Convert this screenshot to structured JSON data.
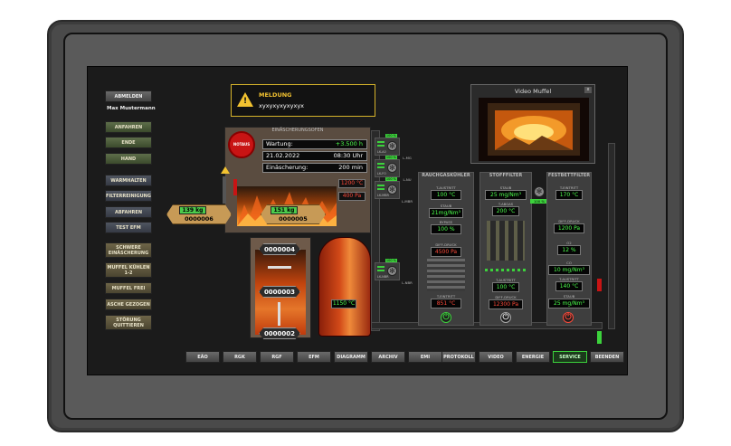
{
  "user": {
    "logout_label": "ABMELDEN",
    "name": "Max Mustermann"
  },
  "left_menu": {
    "group1": [
      "ANFAHREN",
      "ENDE",
      "HAND"
    ],
    "group2": [
      "WARMHALTEN",
      "FILTERREINIGUNG",
      "ABFAHREN",
      "TEST EFM"
    ],
    "group3": [
      "SCHWERE EINÄSCHERUNG",
      "MUFFEL KÜHLEN 1-2",
      "MUFFEL FREI",
      "ASCHE GEZOGEN",
      "STÖRUNG QUITTIEREN"
    ]
  },
  "alarm": {
    "title": "MELDUNG",
    "text": "xyxyxyxyxyxyx"
  },
  "video": {
    "title": "Video Muffel",
    "close": "x"
  },
  "oven": {
    "title": "EINÄSCHERUNGSOFEN",
    "estop_label": "NOTAUS",
    "wartung_label": "Wartung:",
    "wartung_value": "+3.500 h",
    "date": "21.02.2022",
    "time": "08:30 Uhr",
    "einaescherung_label": "Einäscherung:",
    "einaescherung_value": "200 min",
    "temp": "1200 °C",
    "pressure": "400 Pa"
  },
  "coffin_left": {
    "weight": "139 kg",
    "id": "0000006"
  },
  "coffin_oven": {
    "weight": "151 kg",
    "id": "0000005"
  },
  "chamber_ids": [
    "0000004",
    "0000003",
    "0000002"
  ],
  "tank_temp": "1150 °C",
  "fans": [
    {
      "label": "LK-A0",
      "pct": "100 %"
    },
    {
      "label": "LK-FO",
      "pct": "100 %"
    },
    {
      "label": "LK-MBR",
      "pct": "100 %"
    },
    {
      "label": "LK-NBR",
      "pct": "100 %"
    }
  ],
  "fan_tags": [
    "L-MG",
    "L-NU",
    "L-MBR",
    "L-NBR"
  ],
  "rauchgas": {
    "title": "RAUCHGASKÜHLER",
    "t_austritt_label": "T-AUSTRITT",
    "t_austritt": "100 °C",
    "staub_label": "STAUB",
    "staub": "21mg/Nm³",
    "bypass_label": "BYPASS",
    "bypass": "100 %",
    "diff_label": "DIFF-DRUCK",
    "diff": "4500 Pa",
    "t_eintritt_label": "T-EINTRITT",
    "t_eintritt": "851 °C"
  },
  "stoff": {
    "title": "STOFFFILTER",
    "staub_label": "STAUB",
    "staub": "25 mg/Nm³",
    "t_abgas_label": "T-ABGAS",
    "t_abgas": "200 °C",
    "t_austritt_label": "T-AUSTRITT",
    "t_austritt": "100 °C",
    "diff_label": "DIFF-DRUCK",
    "diff": "12300 Pa",
    "fan_pct": "100 %"
  },
  "fest": {
    "title": "FESTBETTFILTER",
    "t_eintritt_label": "T-EINTRITT",
    "t_eintritt": "170 °C",
    "diff_label": "DIFF-DRUCK",
    "diff": "1200 Pa",
    "o2_label": "O2",
    "o2": "12 %",
    "co_label": "CO",
    "co": "10 mg/Nm³",
    "t_austritt_label": "T-AUSTRITT",
    "t_austritt": "140 °C",
    "staub_label": "STAUB",
    "staub": "25 mg/Nm³"
  },
  "bottom_nav": [
    "EÄO",
    "RGK",
    "RGF",
    "EFM",
    "DIAGRAMM",
    "ARCHIV",
    "EMI",
    "PROTOKOLL",
    "VIDEO",
    "ENERGIE",
    "SERVICE",
    "BEENDEN"
  ],
  "colors": {
    "accent_green": "#3cd23c",
    "alarm_yellow": "#f2c230",
    "alarm_red": "#ff4a3a"
  }
}
